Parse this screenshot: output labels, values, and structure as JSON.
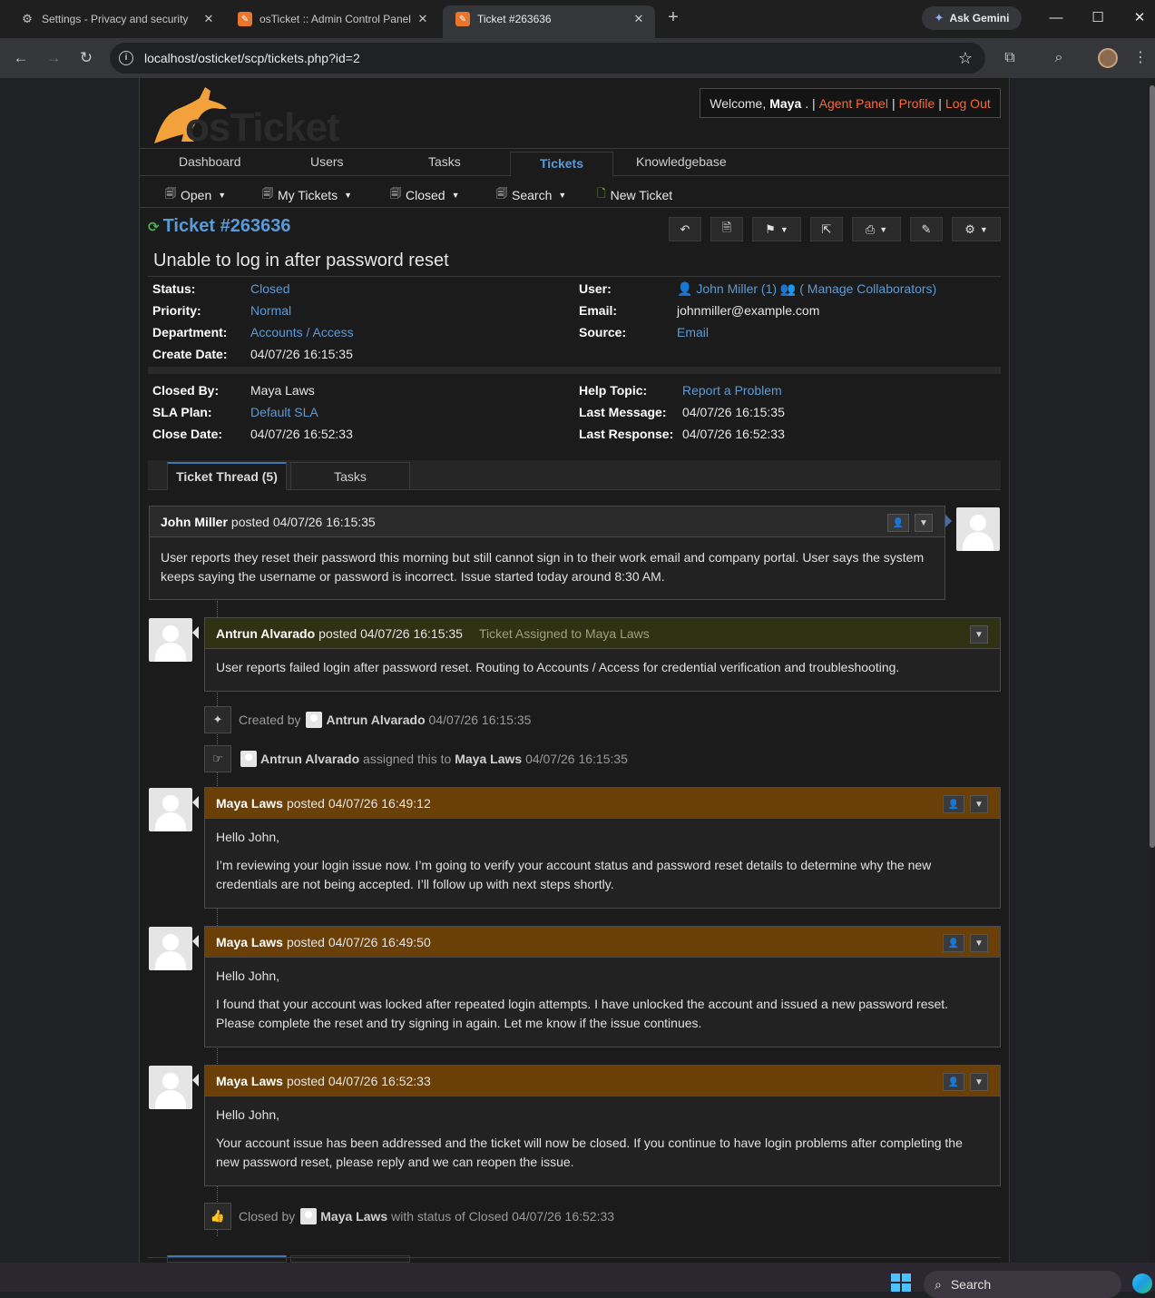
{
  "browser": {
    "tabs": [
      {
        "title": "Settings - Privacy and security",
        "icon": "gear-icon"
      },
      {
        "title": "osTicket :: Admin Control Panel",
        "icon": "osticket-icon"
      },
      {
        "title": "Ticket #263636",
        "icon": "osticket-icon"
      }
    ],
    "gemini_label": "Ask Gemini",
    "url": "localhost/osticket/scp/tickets.php?id=2"
  },
  "header": {
    "welcome_prefix": "Welcome,",
    "user": "Maya",
    "links": [
      "Agent Panel",
      "Profile",
      "Log Out"
    ]
  },
  "nav": {
    "tabs": [
      "Dashboard",
      "Users",
      "Tasks",
      "Tickets",
      "Knowledgebase"
    ],
    "active": "Tickets"
  },
  "subnav": {
    "items": [
      "Open",
      "My Tickets",
      "Closed",
      "Search",
      "New Ticket"
    ]
  },
  "ticket": {
    "number": "Ticket #263636",
    "subject": "Unable to log in after password reset",
    "left1": [
      {
        "label": "Status:",
        "value": "Closed"
      },
      {
        "label": "Priority:",
        "value": "Normal"
      },
      {
        "label": "Department:",
        "value": "Accounts / Access"
      },
      {
        "label": "Create Date:",
        "value": "04/07/26 16:15:35"
      }
    ],
    "right1": {
      "user_label": "User:",
      "user_name": "John Miller (1)",
      "collab": "( Manage Collaborators)",
      "email_label": "Email:",
      "email": "johnmiller@example.com",
      "source_label": "Source:",
      "source": "Email"
    },
    "left2": [
      {
        "label": "Closed By:",
        "value": "Maya Laws"
      },
      {
        "label": "SLA Plan:",
        "value": "Default SLA"
      },
      {
        "label": "Close Date:",
        "value": "04/07/26 16:52:33"
      }
    ],
    "right2": [
      {
        "label": "Help Topic:",
        "value": "Report a Problem"
      },
      {
        "label": "Last Message:",
        "value": "04/07/26 16:15:35"
      },
      {
        "label": "Last Response:",
        "value": "04/07/26 16:52:33"
      }
    ]
  },
  "thread_tabs": {
    "thread": "Ticket Thread (5)",
    "tasks": "Tasks"
  },
  "entries": [
    {
      "author": "John Miller",
      "posted": "posted 04/07/26 16:15:35",
      "body": [
        "User reports they reset their password this morning but still cannot sign in to their work email and company portal. User says the system keeps saying the username or password is incorrect. Issue started today around 8:30 AM."
      ]
    },
    {
      "author": "Antrun Alvarado",
      "posted": "posted 04/07/26 16:15:35",
      "note": "Ticket Assigned to Maya Laws",
      "body": [
        "User reports failed login after password reset. Routing to Accounts / Access for credential verification and troubleshooting."
      ]
    },
    {
      "author": "Maya Laws",
      "posted": "posted 04/07/26 16:49:12",
      "body": [
        "Hello John,",
        "I’m reviewing your login issue now. I’m going to verify your account status and password reset details to determine why the new credentials are not being accepted. I’ll follow up with next steps shortly."
      ]
    },
    {
      "author": "Maya Laws",
      "posted": "posted 04/07/26 16:49:50",
      "body": [
        "Hello John,",
        "I found that your account was locked after repeated login attempts. I have unlocked the account and issued a new password reset. Please complete the reset and try signing in again. Let me know if the issue continues."
      ]
    },
    {
      "author": "Maya Laws",
      "posted": "posted 04/07/26 16:52:33",
      "body": [
        "Hello John,",
        "Your account issue has been addressed and the ticket will now be closed. If you continue to have login problems after completing the new password reset, please reply and we can reopen the issue."
      ]
    }
  ],
  "events": [
    {
      "prefix": "Created by",
      "user": "Antrun Alvarado",
      "suffix": "04/07/26 16:15:35"
    },
    {
      "user": "Antrun Alvarado",
      "mid": "assigned this to",
      "target": "Maya Laws",
      "suffix": "04/07/26 16:15:35"
    },
    {
      "prefix": "Closed by",
      "user": "Maya Laws",
      "suffix": "with status of Closed 04/07/26 16:52:33"
    }
  ],
  "taskbar": {
    "search": "Search"
  }
}
